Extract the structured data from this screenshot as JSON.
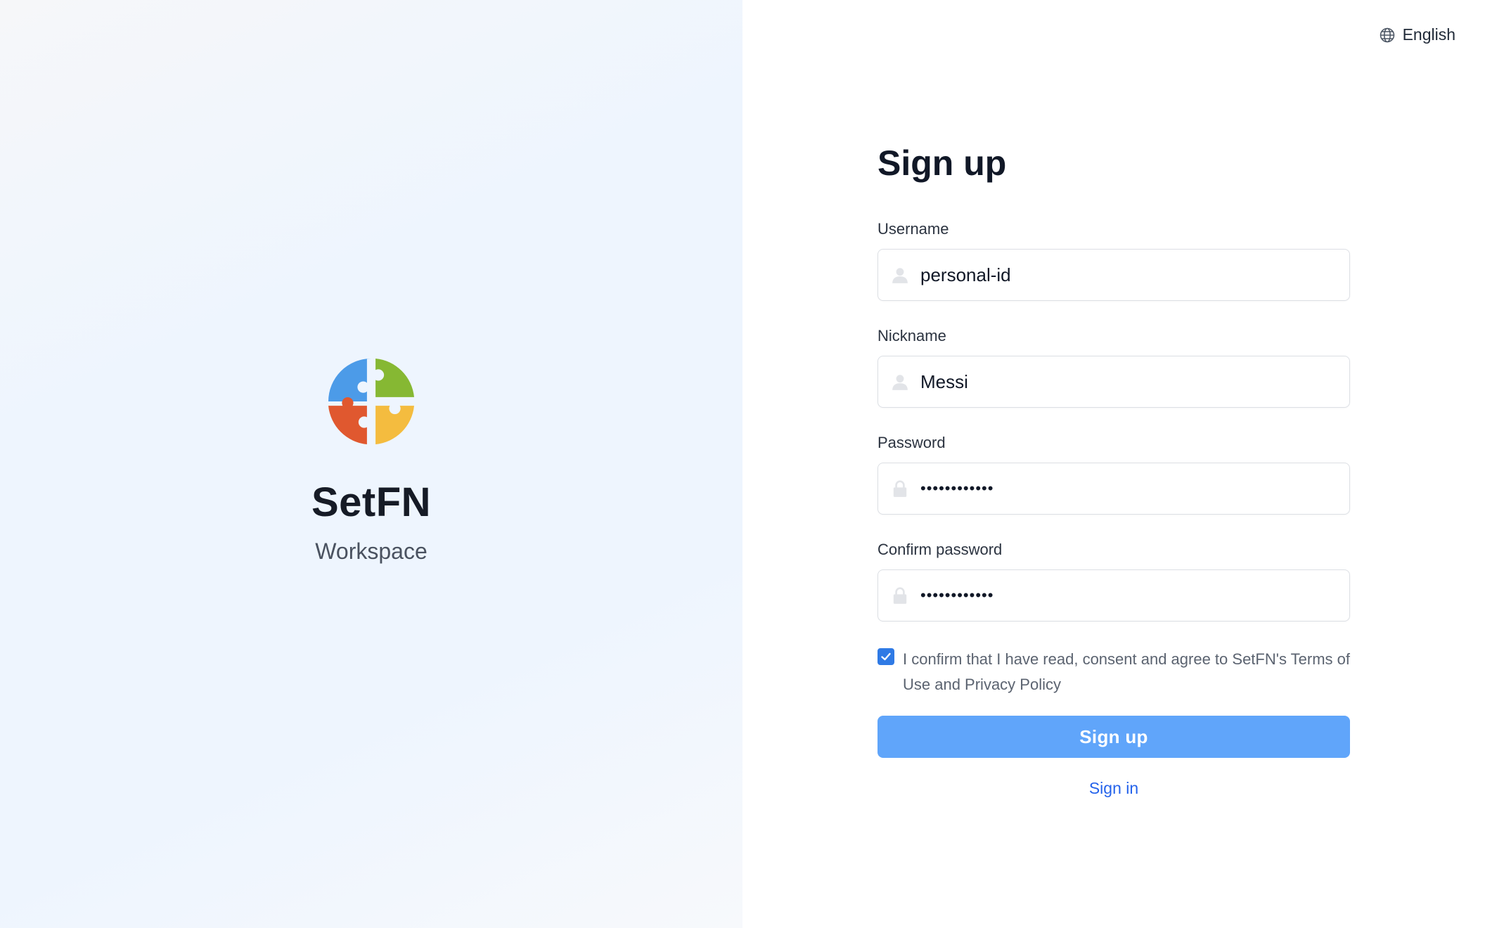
{
  "brand": {
    "name": "SetFN",
    "subtitle": "Workspace",
    "logo_colors": [
      "#4c9be8",
      "#86b833",
      "#e0582f",
      "#f4bc3f"
    ]
  },
  "header": {
    "language": "English",
    "language_icon": "globe-icon"
  },
  "form": {
    "title": "Sign up",
    "fields": [
      {
        "label": "Username",
        "value": "personal-id",
        "icon": "user-icon",
        "type": "text"
      },
      {
        "label": "Nickname",
        "value": "Messi",
        "icon": "user-icon",
        "type": "text"
      },
      {
        "label": "Password",
        "value": "••••••••••••",
        "icon": "lock-icon",
        "type": "password"
      },
      {
        "label": "Confirm password",
        "value": "••••••••••••",
        "icon": "lock-icon",
        "type": "password"
      }
    ],
    "consent": {
      "checked": true,
      "text": "I confirm that I have read, consent and agree to SetFN's Terms of Use and Privacy Policy"
    },
    "submit_label": "Sign up",
    "signin_label": "Sign in"
  },
  "colors": {
    "primary_button": "#60a5fa",
    "link": "#2563eb",
    "checkbox": "#2f7ae5"
  }
}
